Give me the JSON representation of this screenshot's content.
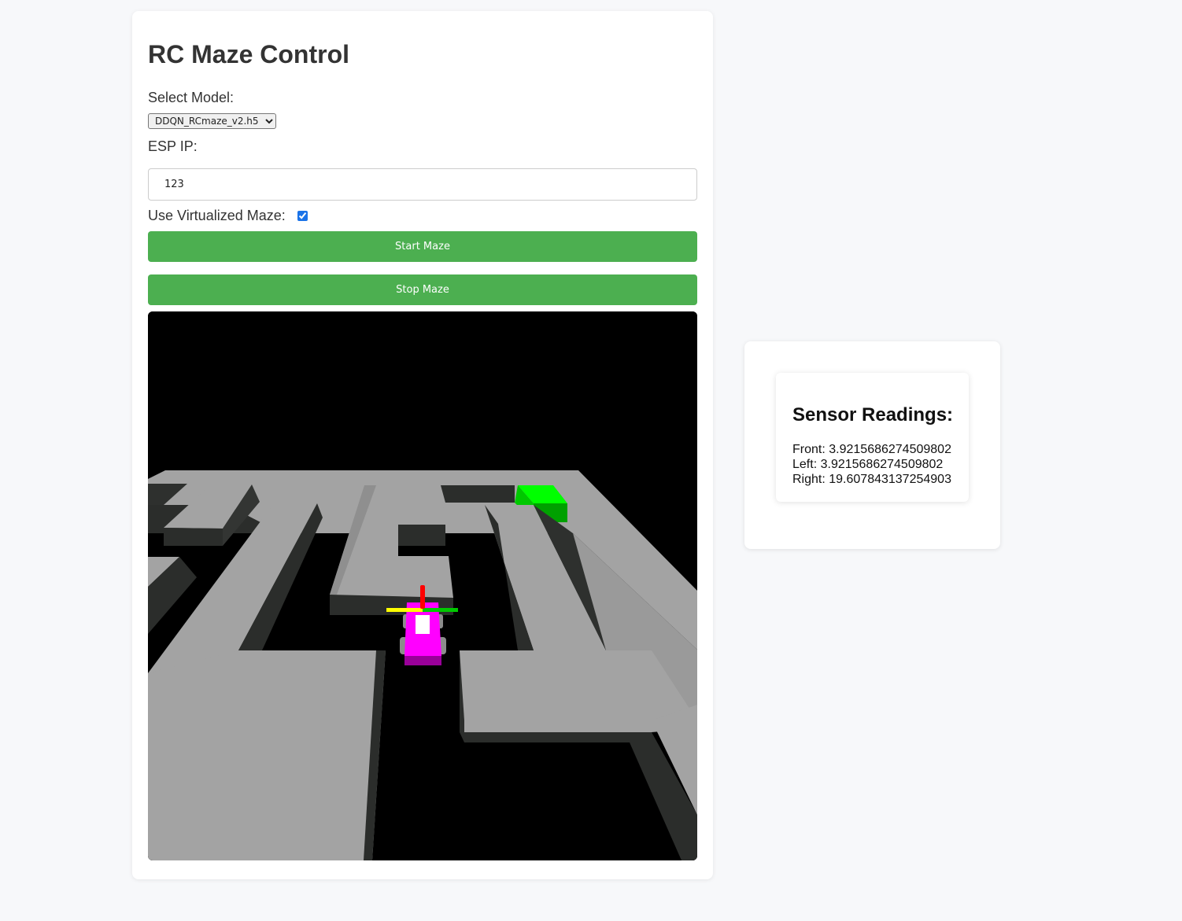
{
  "app": {
    "title": "RC Maze Control"
  },
  "controls": {
    "model_label": "Select Model:",
    "model_selected": "DDQN_RCmaze_v2.h5",
    "ip_label": "ESP IP:",
    "ip_value": "123",
    "virtual_label": "Use Virtualized Maze:",
    "virtual_checked": true,
    "start_label": "Start Maze",
    "stop_label": "Stop Maze"
  },
  "colors": {
    "button": "#4caf50",
    "car": "#ff00ff",
    "goal": "#00ff00",
    "floor": "#a0a0a0",
    "wall_side": "#2b2d2b"
  },
  "sensors": {
    "title": "Sensor Readings:",
    "front_label": "Front:",
    "front_value": "3.9215686274509802",
    "left_label": "Left:",
    "left_value": "3.9215686274509802",
    "right_label": "Right:",
    "right_value": "19.607843137254903"
  }
}
